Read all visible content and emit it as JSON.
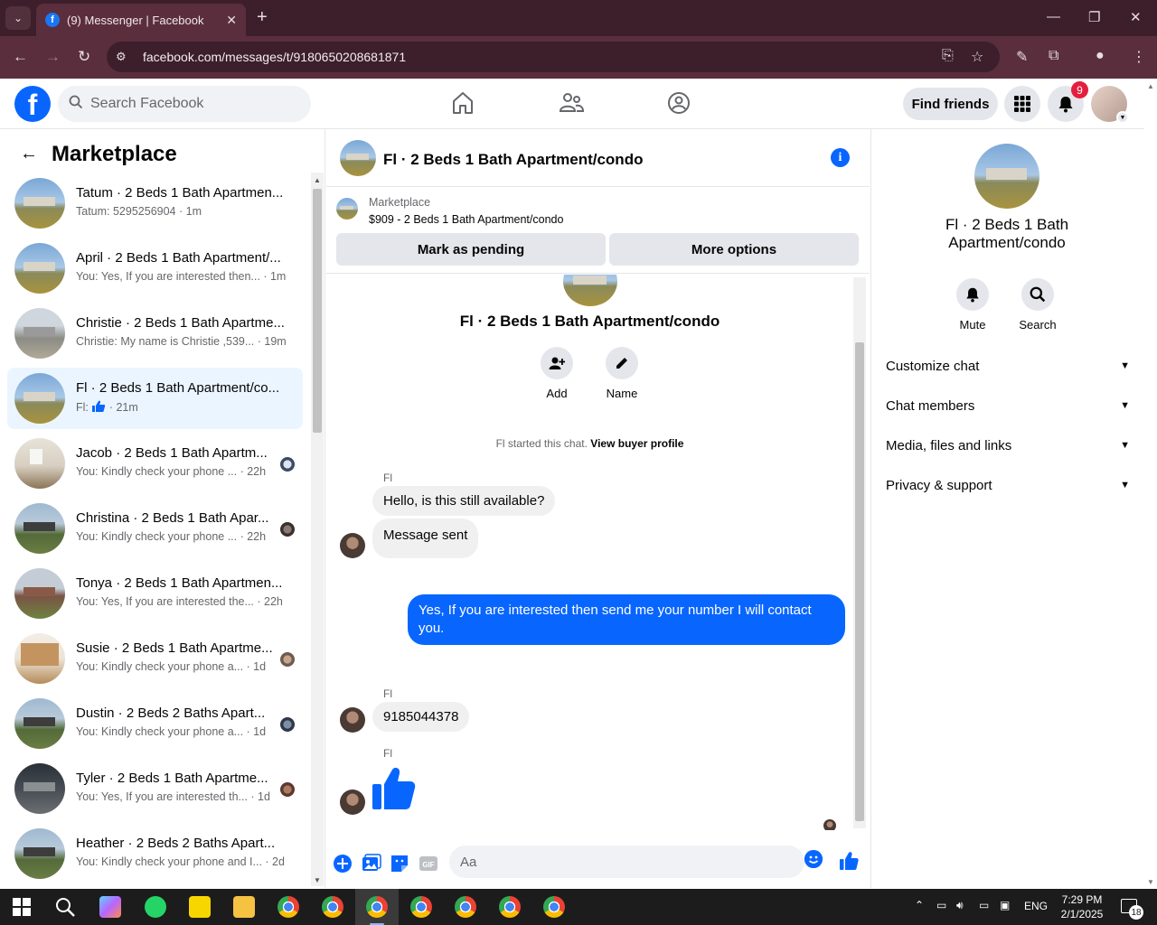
{
  "browser": {
    "tab_title": "(9) Messenger | Facebook",
    "url": "facebook.com/messages/t/9180650208681871"
  },
  "header": {
    "search_placeholder": "Search Facebook",
    "find_friends": "Find friends",
    "notification_count": "9",
    "brand_color": "#0866ff"
  },
  "sidebar": {
    "title": "Marketplace",
    "conversations": [
      {
        "title": "Tatum · 2 Beds 1 Bath Apartmen...",
        "subtitle": "Tatum: 5295256904 · 1m",
        "thumb": "house"
      },
      {
        "title": "April · 2 Beds 1 Bath Apartment/...",
        "subtitle": "You: Yes, If you are interested then... · 1m",
        "thumb": "house"
      },
      {
        "title": "Christie · 2 Beds 1 Bath Apartme...",
        "subtitle": "Christie: My name is Christie ,539... · 19m",
        "thumb": "gray"
      },
      {
        "title": "Fl · 2 Beds 1 Bath Apartment/co...",
        "subtitle_prefix": "Fl: ",
        "subtitle_suffix": " · 21m",
        "thumb": "house",
        "active": true
      },
      {
        "title": "Jacob · 2 Beds 1 Bath Apartm...",
        "subtitle": "You: Kindly check your phone ... · 22h",
        "thumb": "interior"
      },
      {
        "title": "Christina · 2 Beds 1 Bath Apar...",
        "subtitle": "You: Kindly check your phone ... · 22h",
        "thumb": "dark"
      },
      {
        "title": "Tonya · 2 Beds 1 Bath Apartmen...",
        "subtitle": "You: Yes, If you are interested the... · 22h",
        "thumb": "brick"
      },
      {
        "title": "Susie · 2 Beds 1 Bath Apartme...",
        "subtitle": "You: Kindly check your phone a... · 1d",
        "thumb": "kitchen"
      },
      {
        "title": "Dustin · 2 Beds 2 Baths Apart...",
        "subtitle": "You: Kindly check your phone a... · 1d",
        "thumb": "dark"
      },
      {
        "title": "Tyler · 2 Beds 1 Bath Apartme...",
        "subtitle": "You: Yes, If you are interested th... · 1d",
        "thumb": "night"
      },
      {
        "title": "Heather · 2 Beds 2 Baths Apart...",
        "subtitle": "You: Kindly check your phone and I... · 2d",
        "thumb": "dark"
      }
    ]
  },
  "chat": {
    "title": "Fl · 2 Beds 1 Bath Apartment/condo",
    "marketplace_label": "Marketplace",
    "listing": "$909 - 2 Beds 1 Bath Apartment/condo",
    "mark_pending": "Mark as pending",
    "more_options": "More options",
    "center_title": "Fl · 2 Beds 1 Bath Apartment/condo",
    "add_label": "Add",
    "name_label": "Name",
    "started_text": "Fl started this chat.",
    "view_profile": "View buyer profile",
    "sender": "Fl",
    "messages": {
      "m1": "Hello, is this still available?",
      "m2": "Message sent",
      "m3": "Yes, If you are interested then send me your number I will contact you.",
      "m4": "9185044378"
    },
    "composer_placeholder": "Aa",
    "gif_label": "GIF"
  },
  "right_panel": {
    "title": "Fl · 2 Beds 1 Bath Apartment/condo",
    "mute": "Mute",
    "search": "Search",
    "sections": [
      "Customize chat",
      "Chat members",
      "Media, files and links",
      "Privacy & support"
    ]
  },
  "taskbar": {
    "lang": "ENG",
    "time": "7:29 PM",
    "date": "2/1/2025",
    "notifications": "18"
  }
}
